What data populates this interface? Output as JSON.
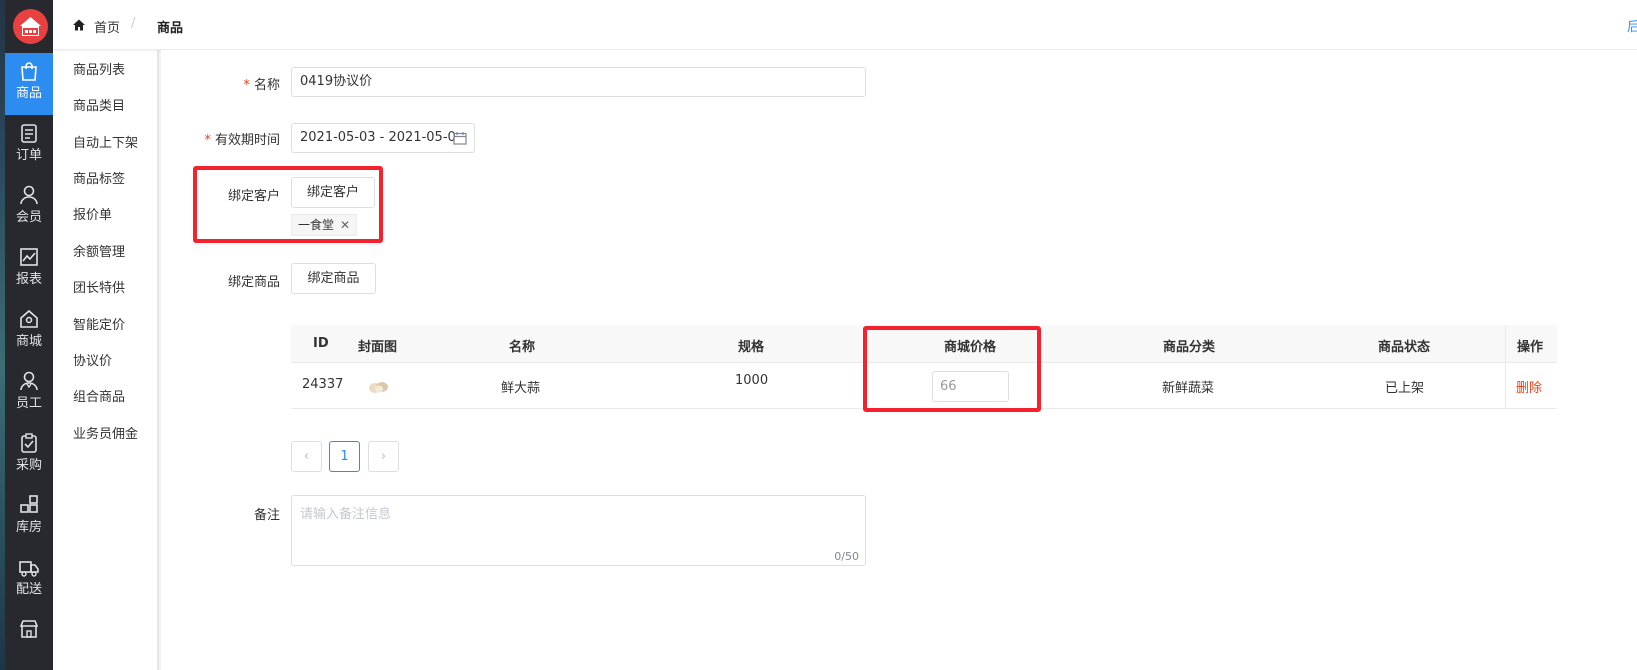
{
  "colors": {
    "accent": "#2d8cf0",
    "sidebar_bg": "#27292e",
    "highlight_red": "#f5222d",
    "danger": "#ed4014"
  },
  "sidebar": {
    "items": [
      {
        "label": "商品",
        "icon": "shopping-bag-icon",
        "active": true
      },
      {
        "label": "订单",
        "icon": "order-document-icon"
      },
      {
        "label": "会员",
        "icon": "member-user-icon"
      },
      {
        "label": "报表",
        "icon": "report-chart-icon"
      },
      {
        "label": "商城",
        "icon": "mall-home-icon"
      },
      {
        "label": "员工",
        "icon": "staff-icon"
      },
      {
        "label": "采购",
        "icon": "purchase-clipboard-icon"
      },
      {
        "label": "库房",
        "icon": "warehouse-icon"
      },
      {
        "label": "配送",
        "icon": "delivery-truck-icon"
      }
    ]
  },
  "submenu": {
    "items": [
      "商品列表",
      "商品类目",
      "自动上下架",
      "商品标签",
      "报价单",
      "余额管理",
      "团长特供",
      "智能定价",
      "协议价",
      "组合商品",
      "业务员佣金"
    ]
  },
  "header": {
    "breadcrumb_home": "首页",
    "breadcrumb_sep": "/",
    "breadcrumb_current": "商品",
    "right_text": "后"
  },
  "form": {
    "name_label": "名称",
    "name_value": "0419协议价",
    "period_label": "有效期时间",
    "period_value": "2021-05-03 - 2021-05-0",
    "bind_customer_label": "绑定客户",
    "bind_customer_button": "绑定客户",
    "customer_tag": "一食堂",
    "bind_product_label": "绑定商品",
    "bind_product_button": "绑定商品",
    "remark_label": "备注",
    "remark_placeholder": "请输入备注信息",
    "remark_count": "0/50"
  },
  "table": {
    "columns": [
      "ID",
      "封面图",
      "名称",
      "规格",
      "商城价格",
      "商品分类",
      "商品状态",
      "操作"
    ],
    "rows": [
      {
        "id": "24337",
        "name": "鲜大蒜",
        "spec": "1000",
        "price": "66",
        "category": "新鲜蔬菜",
        "status": "已上架",
        "action": "删除"
      }
    ]
  },
  "pagination": {
    "current": "1",
    "prev": "‹",
    "next": "›"
  }
}
